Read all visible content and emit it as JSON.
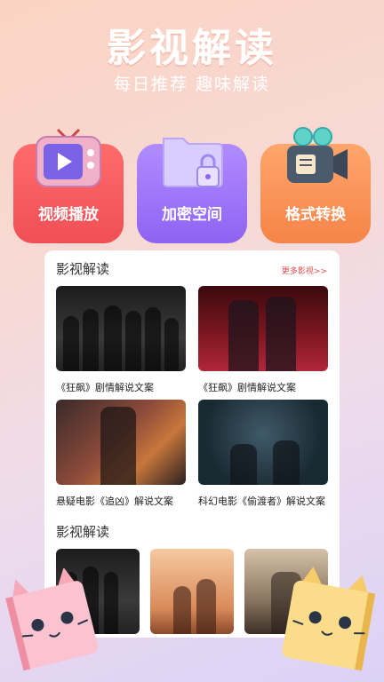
{
  "hero": {
    "title": "影视解读",
    "subtitle": "每日推荐 趣味解读"
  },
  "tiles": [
    {
      "label": "视频播放",
      "icon": "tv-icon",
      "color": "#ef4f55"
    },
    {
      "label": "加密空间",
      "icon": "folder-lock-icon",
      "color": "#8e63f3"
    },
    {
      "label": "格式转换",
      "icon": "camera-icon",
      "color": "#f58448"
    }
  ],
  "section1": {
    "title": "影视解读",
    "more": "更多影视>>",
    "cards": [
      {
        "caption": "《狂飙》剧情解说文案"
      },
      {
        "caption": "《狂飙》剧情解说文案"
      },
      {
        "caption": "悬疑电影《追凶》解说文案"
      },
      {
        "caption": "科幻电影《偷渡者》解说文案"
      }
    ]
  },
  "section2": {
    "title": "影视解读"
  },
  "colors": {
    "accent_red": "#e24b4b",
    "background_start": "#fbd3c3",
    "background_end": "#dcd2f7"
  }
}
